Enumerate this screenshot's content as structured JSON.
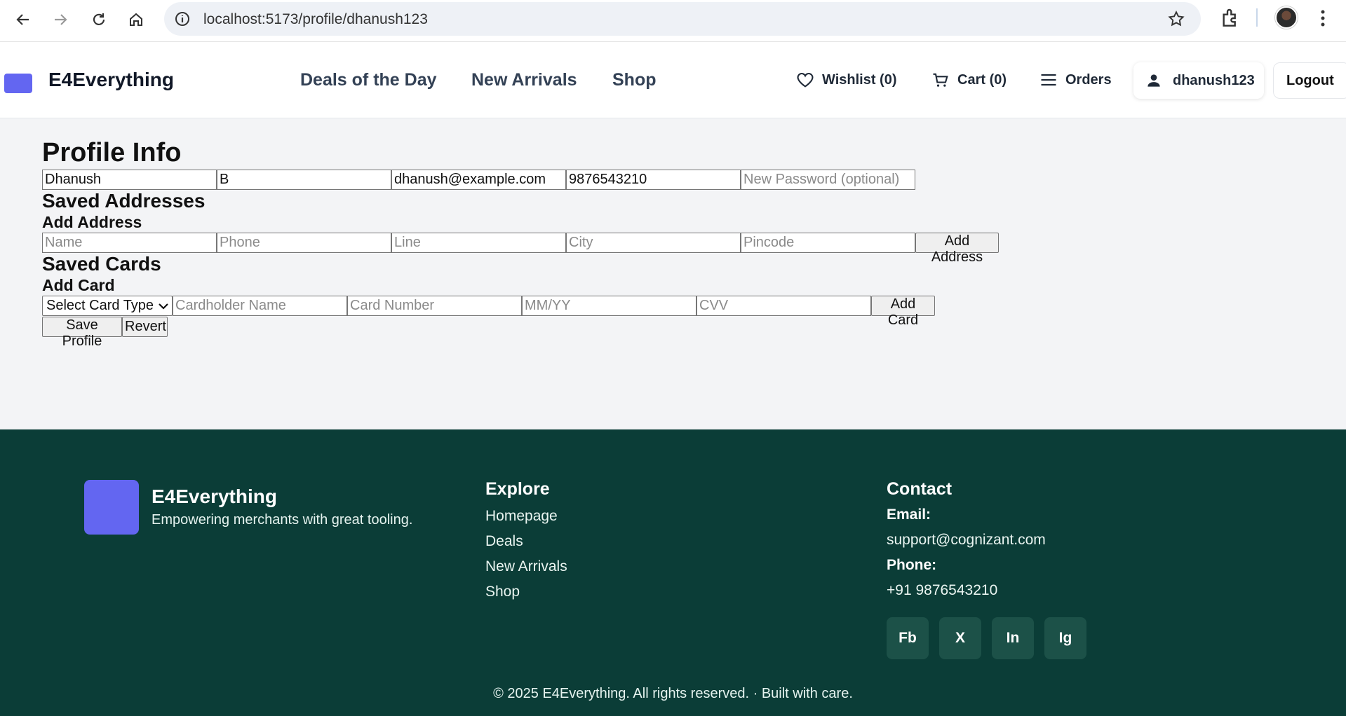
{
  "browser": {
    "url": "localhost:5173/profile/dhanush123",
    "icons": [
      "back-arrow-icon",
      "forward-arrow-icon",
      "reload-icon",
      "home-icon",
      "site-info-icon",
      "star-icon",
      "extensions-icon",
      "profile-avatar",
      "more-menu-icon"
    ]
  },
  "header": {
    "brand": "E4Everything",
    "nav": [
      "Deals of the Day",
      "New Arrivals",
      "Shop"
    ],
    "wishlist": "Wishlist (0)",
    "cart": "Cart (0)",
    "orders": "Orders",
    "user": "dhanush123",
    "logout": "Logout",
    "logo_color": "#6366f1"
  },
  "profile": {
    "title": "Profile Info",
    "first_name": "Dhanush",
    "last_name": "B",
    "email": "dhanush@example.com",
    "phone": "9876543210",
    "password_placeholder": "New Password (optional)",
    "saved_addresses_title": "Saved Addresses",
    "add_address_title": "Add Address",
    "address_placeholders": {
      "name": "Name",
      "phone": "Phone",
      "line": "Line",
      "city": "City",
      "pincode": "Pincode"
    },
    "add_address_button": "Add Address",
    "saved_cards_title": "Saved Cards",
    "add_card_title": "Add Card",
    "card_type_selected": "Select Card Type",
    "card_placeholders": {
      "holder": "Cardholder Name",
      "number": "Card Number",
      "expiry": "MM/YY",
      "cvv": "CVV"
    },
    "add_card_button": "Add Card",
    "save_button": "Save Profile",
    "revert_button": "Revert"
  },
  "footer": {
    "brand": "E4Everything",
    "tagline": "Empowering merchants with great tooling.",
    "explore_title": "Explore",
    "explore_links": [
      "Homepage",
      "Deals",
      "New Arrivals",
      "Shop"
    ],
    "contact_title": "Contact",
    "email_label": "Email:",
    "email": "support@cognizant.com",
    "phone_label": "Phone:",
    "phone": "+91 9876543210",
    "social": [
      "Fb",
      "X",
      "In",
      "Ig"
    ],
    "copyright": "© 2025 E4Everything. All rights reserved. · Built with care.",
    "background_color": "#0b3d37"
  }
}
